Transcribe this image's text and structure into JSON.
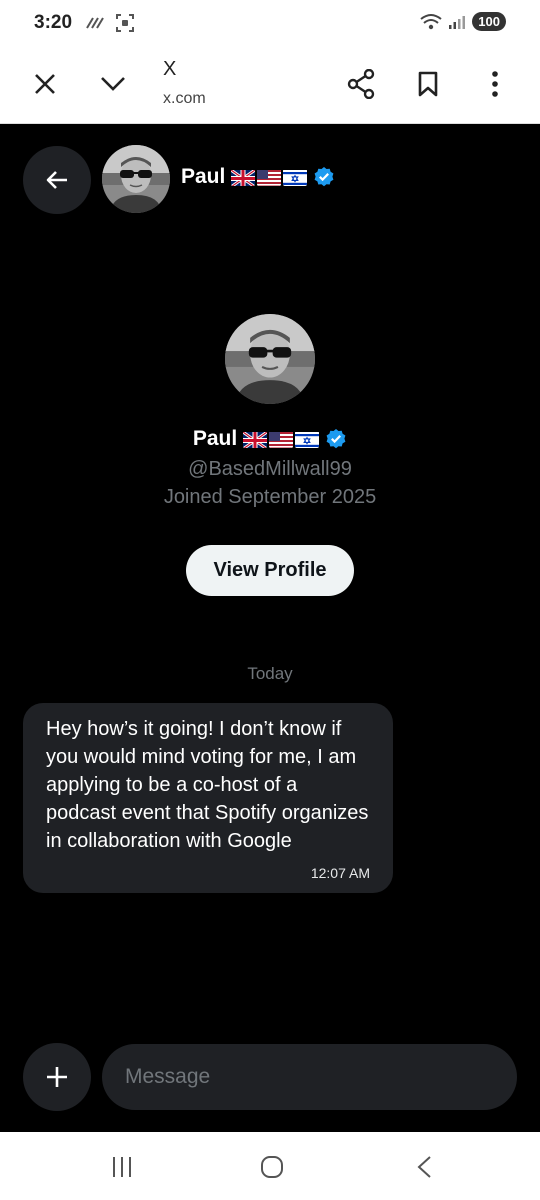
{
  "status_bar": {
    "time": "3:20",
    "battery": "100"
  },
  "browser": {
    "title": "X",
    "url": "x.com"
  },
  "header": {
    "name": "Paul"
  },
  "profile": {
    "name": "Paul",
    "handle": "@BasedMillwall99",
    "joined": "Joined September 2025",
    "view_profile_label": "View Profile"
  },
  "conversation": {
    "day_label": "Today",
    "messages": [
      {
        "text": "Hey how’s it going! I don’t know if you would mind voting for me, I am applying to be a co-host of a podcast event that Spotify organizes in collaboration with Google",
        "time": "12:07 AM"
      }
    ]
  },
  "composer": {
    "placeholder": "Message"
  },
  "icons": {
    "verified": "verified-badge-icon",
    "flags": [
      "uk-flag-icon",
      "us-flag-icon",
      "israel-flag-icon"
    ]
  },
  "colors": {
    "background": "#000000",
    "bubble": "#1f2125",
    "verified": "#1d9bf0",
    "muted_text": "#71767b",
    "view_profile_button": "#eff3f4"
  }
}
